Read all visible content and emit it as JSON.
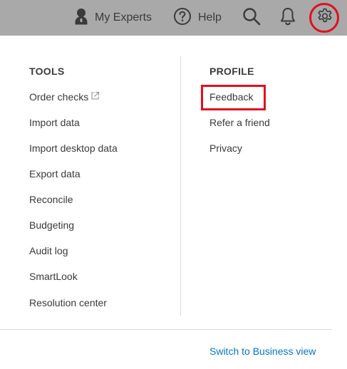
{
  "topbar": {
    "experts_label": "My Experts",
    "help_label": "Help",
    "icons": [
      "user-icon",
      "help-icon",
      "search-icon",
      "bell-icon",
      "gear-icon"
    ],
    "background_color": "#a9a9a9",
    "highlight_color": "#e0101f"
  },
  "menu": {
    "tools": {
      "heading": "TOOLS",
      "items": [
        "Order checks",
        "Import data",
        "Import desktop data",
        "Export data",
        "Reconcile",
        "Budgeting",
        "Audit log",
        "SmartLook",
        "Resolution center"
      ]
    },
    "profile": {
      "heading": "PROFILE",
      "items": [
        "Feedback",
        "Refer a friend",
        "Privacy"
      ]
    },
    "switch_view_label": "Switch to Business view",
    "link_color": "#0077c5"
  }
}
